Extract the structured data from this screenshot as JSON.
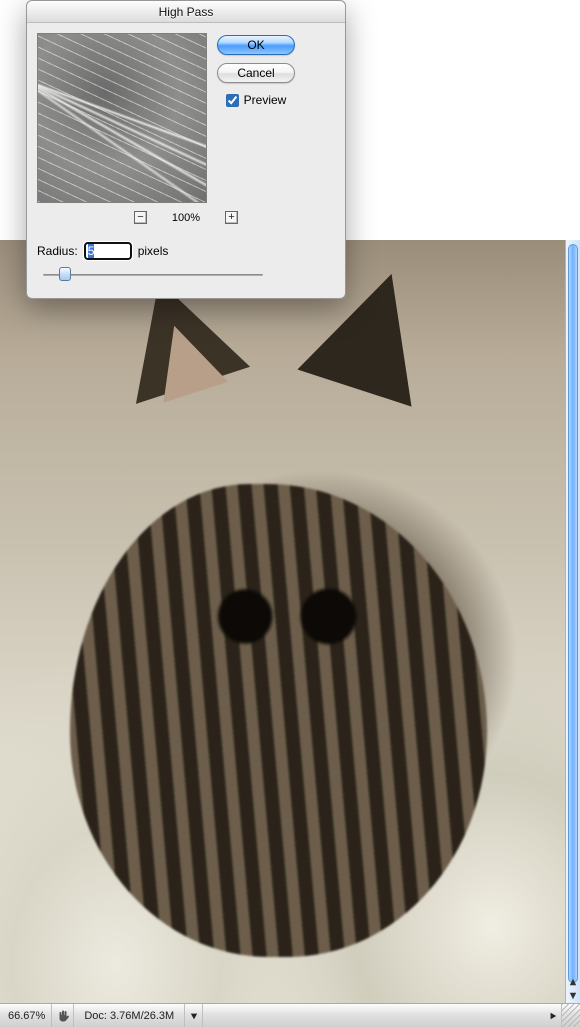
{
  "dialog": {
    "title": "High Pass",
    "ok_label": "OK",
    "cancel_label": "Cancel",
    "preview_label": "Preview",
    "preview_checked": true,
    "zoom_minus": "−",
    "zoom_plus": "+",
    "zoom_value": "100%",
    "radius_label": "Radius:",
    "radius_value": "5",
    "radius_unit": "pixels"
  },
  "status": {
    "zoom": "66.67%",
    "doc_label": "Doc:",
    "doc_value": "3.76M/26.3M"
  }
}
